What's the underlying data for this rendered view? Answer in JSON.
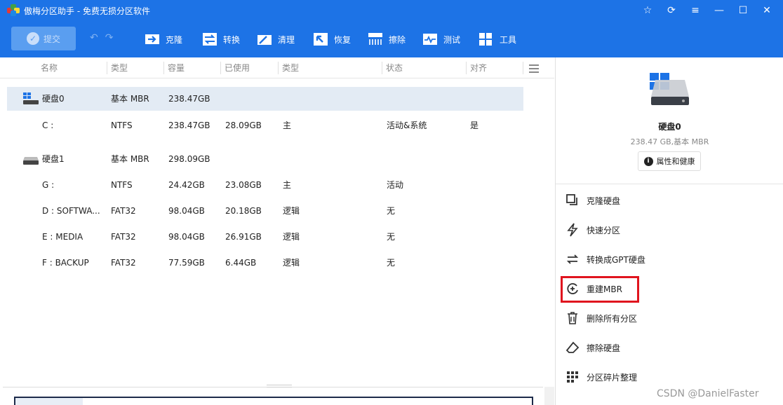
{
  "window": {
    "title": "傲梅分区助手 - 免费无损分区软件",
    "controls": [
      "☆",
      "⟳",
      "≡",
      "—",
      "☐",
      "✕"
    ]
  },
  "toolbar": {
    "commit_label": "提交",
    "undo_icon": "undo-icon",
    "redo_icon": "redo-icon",
    "items": [
      {
        "label": "克隆",
        "icon": "clone-icon"
      },
      {
        "label": "转换",
        "icon": "convert-icon"
      },
      {
        "label": "清理",
        "icon": "clean-icon"
      },
      {
        "label": "恢复",
        "icon": "recover-icon"
      },
      {
        "label": "擦除",
        "icon": "wipe-icon"
      },
      {
        "label": "测试",
        "icon": "test-icon"
      },
      {
        "label": "工具",
        "icon": "tools-icon"
      }
    ]
  },
  "table": {
    "headers": [
      "名称",
      "类型",
      "容量",
      "已使用",
      "类型",
      "状态",
      "对齐"
    ],
    "rows": [
      {
        "kind": "disk",
        "name": "硬盘0",
        "type": "基本 MBR",
        "capacity": "238.47GB",
        "used": "",
        "ptype": "",
        "status": "",
        "align": "",
        "selected": true
      },
      {
        "kind": "part",
        "name": "C :",
        "type": "NTFS",
        "capacity": "238.47GB",
        "used": "28.09GB",
        "ptype": "主",
        "status": "活动&系统",
        "align": "是"
      },
      {
        "kind": "disk",
        "name": "硬盘1",
        "type": "基本 MBR",
        "capacity": "298.09GB",
        "used": "",
        "ptype": "",
        "status": "",
        "align": ""
      },
      {
        "kind": "part",
        "name": "G :",
        "type": "NTFS",
        "capacity": "24.42GB",
        "used": "23.08GB",
        "ptype": "主",
        "status": "活动",
        "align": ""
      },
      {
        "kind": "part",
        "name": "D : SOFTWA...",
        "type": "FAT32",
        "capacity": "98.04GB",
        "used": "20.18GB",
        "ptype": "逻辑",
        "status": "无",
        "align": ""
      },
      {
        "kind": "part",
        "name": "E : MEDIA",
        "type": "FAT32",
        "capacity": "98.04GB",
        "used": "26.91GB",
        "ptype": "逻辑",
        "status": "无",
        "align": ""
      },
      {
        "kind": "part",
        "name": "F : BACKUP",
        "type": "FAT32",
        "capacity": "77.59GB",
        "used": "6.44GB",
        "ptype": "逻辑",
        "status": "无",
        "align": ""
      }
    ]
  },
  "right_panel": {
    "disk_title": "硬盘0",
    "disk_sub": "238.47 GB,基本 MBR",
    "prop_button": "属性和健康",
    "actions": [
      {
        "label": "克隆硬盘",
        "icon": "clone-disk-icon"
      },
      {
        "label": "快速分区",
        "icon": "lightning-icon"
      },
      {
        "label": "转换成GPT硬盘",
        "icon": "convert-arrows-icon"
      },
      {
        "label": "重建MBR",
        "icon": "rebuild-mbr-icon"
      },
      {
        "label": "删除所有分区",
        "icon": "trash-icon"
      },
      {
        "label": "擦除硬盘",
        "icon": "eraser-icon"
      },
      {
        "label": "分区碎片整理",
        "icon": "defrag-icon"
      }
    ]
  },
  "watermark": "CSDN @DanielFaster"
}
